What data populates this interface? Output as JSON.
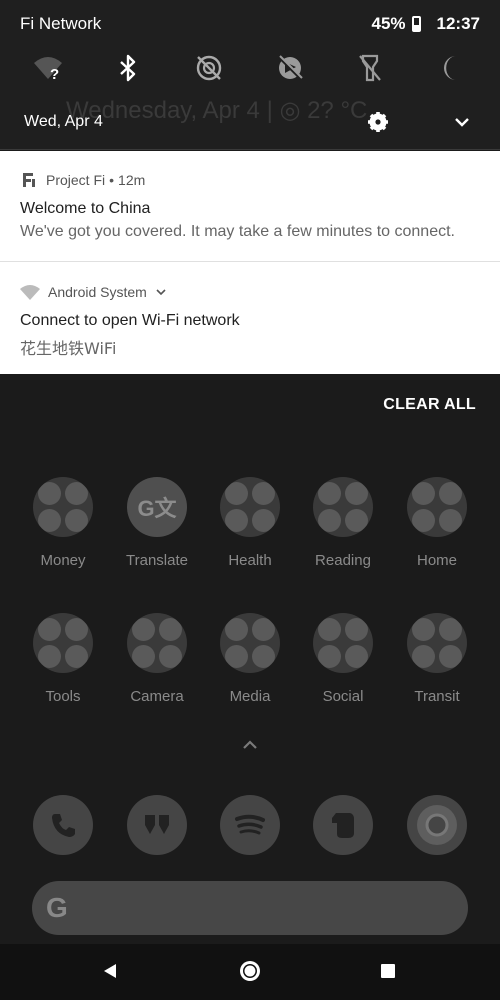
{
  "status_bar": {
    "carrier": "Fi Network",
    "battery": "45%",
    "time": "12:37"
  },
  "quick_settings": {
    "tiles": [
      "wifi-unknown-icon",
      "bluetooth-icon",
      "do-not-disturb-icon",
      "location-off-icon",
      "flashlight-off-icon",
      "night-mode-icon"
    ],
    "date": "Wed, Apr 4",
    "ghost_text": "Wednesday, Apr 4 | ◎ 2? °C"
  },
  "notifications": [
    {
      "app": "Project Fi",
      "separator": "•",
      "time": "12m",
      "title": "Welcome to China",
      "text": "We've got you covered. It may take a few minutes to connect."
    },
    {
      "app": "Android System",
      "title": "Connect to open Wi-Fi network",
      "text": "花生地铁WiFi"
    }
  ],
  "clear_all": "CLEAR ALL",
  "home": {
    "row1": [
      "Money",
      "Translate",
      "Health",
      "Reading",
      "Home"
    ],
    "row2": [
      "Tools",
      "Camera",
      "Media",
      "Social",
      "Transit"
    ],
    "translate_glyph": "G文"
  },
  "dock": [
    "phone-icon",
    "hangouts-icon",
    "spotify-icon",
    "evernote-icon",
    "chrome-icon"
  ],
  "search": {
    "logo": "G"
  },
  "colors": {
    "panel": "#1f1f1f",
    "card": "#ffffff",
    "home_dim": "#1b1b1b"
  }
}
